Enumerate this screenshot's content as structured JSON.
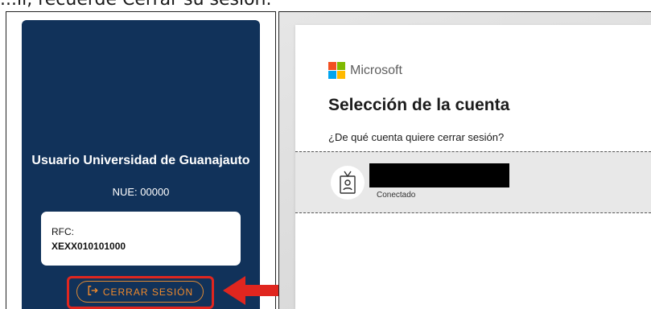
{
  "caption": "...ll, recuerde Cerrar su sesión.",
  "profile": {
    "name": "Usuario Universidad de Guanajauto",
    "nue": "NUE: 00000",
    "rfc_label": "RFC:",
    "rfc_value": "XEXX010101000",
    "logout_label": "CERRAR SESIÓN",
    "card_color": "#11325a",
    "logout_color": "#f08a2c"
  },
  "annotation": {
    "highlight_color": "#e0261f",
    "arrow_color": "#e0261f"
  },
  "microsoft": {
    "brand": "Microsoft",
    "logo_colors": [
      "#f25022",
      "#7fba00",
      "#00a4ef",
      "#ffb900"
    ],
    "title": "Selección de la cuenta",
    "question": "¿De qué cuenta quiere cerrar sesión?",
    "account": {
      "icon": "badge-icon",
      "status": "Conectado"
    }
  }
}
